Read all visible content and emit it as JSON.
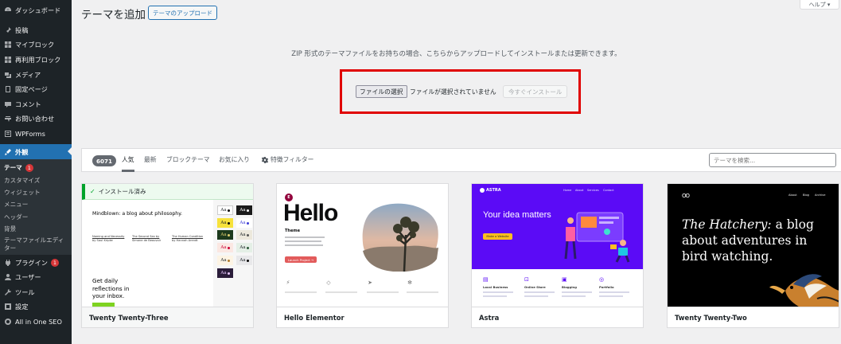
{
  "sidebar": {
    "items": [
      {
        "label": "ダッシュボード",
        "icon": "dashboard-icon"
      },
      {
        "label": "投稿",
        "icon": "pin-icon"
      },
      {
        "label": "マイブロック",
        "icon": "block-icon"
      },
      {
        "label": "再利用ブロック",
        "icon": "reusable-block-icon"
      },
      {
        "label": "メディア",
        "icon": "media-icon"
      },
      {
        "label": "固定ページ",
        "icon": "page-icon"
      },
      {
        "label": "コメント",
        "icon": "comment-icon"
      },
      {
        "label": "お問い合わせ",
        "icon": "contact-icon"
      },
      {
        "label": "WPForms",
        "icon": "wpforms-icon"
      },
      {
        "label": "外観",
        "icon": "appearance-icon"
      },
      {
        "label": "プラグイン",
        "icon": "plugin-icon",
        "badge": "1"
      },
      {
        "label": "ユーザー",
        "icon": "user-icon"
      },
      {
        "label": "ツール",
        "icon": "tools-icon"
      },
      {
        "label": "設定",
        "icon": "settings-icon"
      },
      {
        "label": "All in One SEO",
        "icon": "seo-icon"
      }
    ],
    "appearance_submenu": [
      {
        "label": "テーマ",
        "badge": "1"
      },
      {
        "label": "カスタマイズ"
      },
      {
        "label": "ウィジェット"
      },
      {
        "label": "メニュー"
      },
      {
        "label": "ヘッダー"
      },
      {
        "label": "背景"
      },
      {
        "label": "テーマファイルエディター"
      }
    ]
  },
  "header": {
    "title": "テーマを追加",
    "upload_button": "テーマのアップロード",
    "help": "ヘルプ ▾"
  },
  "upload": {
    "description": "ZIP 形式のテーマファイルをお持ちの場合、こちらからアップロードしてインストールまたは更新できます。",
    "file_button": "ファイルの選択",
    "file_status": "ファイルが選択されていません",
    "install_button": "今すぐインストール",
    "highlight_color": "#e00000"
  },
  "filter": {
    "count": "6071",
    "tabs": [
      "人気",
      "最新",
      "ブロックテーマ",
      "お気に入り"
    ],
    "feature_filter": "特徴フィルター",
    "search_placeholder": "テーマを検索..."
  },
  "themes": [
    {
      "name": "Twenty Twenty-Three",
      "installed_label": "インストール済み",
      "screenshot": {
        "headline": "Mindblown: a blog about philosophy.",
        "posts": [
          {
            "title": "Naming and Necessity",
            "meta": "by Saul Kripke"
          },
          {
            "title": "The Second Sex by",
            "meta": "Simone de Beauvoir"
          },
          {
            "title": "The Human Condition",
            "meta": "by Hannah Arendt"
          }
        ],
        "cta": "Get daily reflections in your inbox.",
        "swatch_label": "Aa"
      }
    },
    {
      "name": "Hello Elementor",
      "screenshot": {
        "logo": "E",
        "title": "Hello",
        "subtitle": "Theme",
        "button": "Launch Project →"
      }
    },
    {
      "name": "Astra",
      "screenshot": {
        "logo": "ASTRA",
        "nav": [
          "Home",
          "About",
          "Services",
          "Contact"
        ],
        "heading": "Your idea matters",
        "button": "Make a Website",
        "features": [
          "Local Business",
          "Online Store",
          "Blogging",
          "Portfolio"
        ],
        "accent": "#5b0bf6"
      }
    },
    {
      "name": "Twenty Twenty-Two",
      "screenshot": {
        "logo": "OO",
        "nav": [
          "About",
          "Blog",
          "Archive"
        ],
        "heading_italic": "The Hatchery:",
        "heading_rest": " a blog about adventures in bird watching."
      }
    }
  ]
}
